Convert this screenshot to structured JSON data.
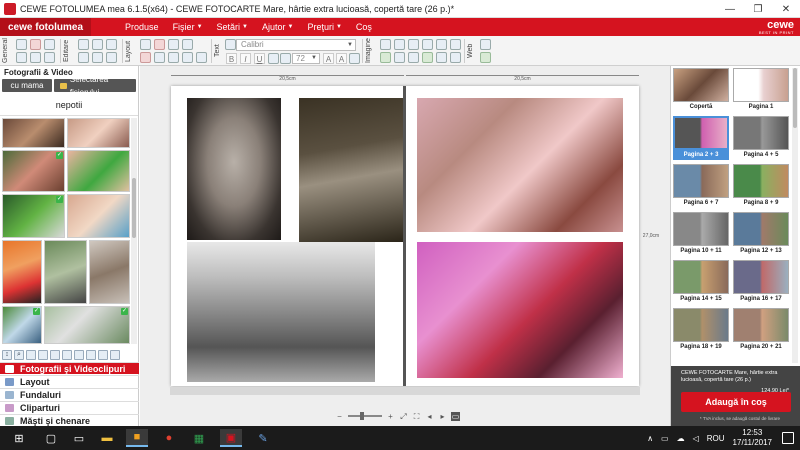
{
  "window": {
    "title": "CEWE FOTOLUMEA mea 6.1.5(x64) - CEWE FOTOCARTE Mare, hârtie extra lucioasă, copertă tare (26 p.)*",
    "controls": [
      "—",
      "❐",
      "✕"
    ]
  },
  "menubar": {
    "brand": "cewe fotolumea",
    "items": [
      "Produse",
      "Fişier",
      "Setări",
      "Ajutor",
      "Preţuri",
      "Coş"
    ],
    "logo_word": "cewe",
    "logo_sub": "BEST IN PRINT"
  },
  "toolbar": {
    "groups": [
      "General",
      "Editare",
      "Layout",
      "Text",
      "Imagine",
      "Web"
    ],
    "font_name": "Calibri",
    "font_size": "72"
  },
  "left_panel": {
    "heading": "Fotografii & Video",
    "tab_album": "cu mama",
    "tab_select": "Selectarea fişierului",
    "album_name": "nepotii",
    "sections": [
      "Fotografii şi Videoclipuri",
      "Layout",
      "Fundaluri",
      "Cliparturi",
      "Măşti şi chenare"
    ]
  },
  "canvas": {
    "ruler_left": "20,5cm",
    "ruler_right": "20,5cm",
    "ruler_vertical": "27,0cm"
  },
  "right_panel": {
    "pages": [
      "Copertă",
      "Pagina 1",
      "Pagina 2 + 3",
      "Pagina 4 + 5",
      "Pagina 6 + 7",
      "Pagina 8 + 9",
      "Pagina 10 + 11",
      "Pagina 12 + 13",
      "Pagina 14 + 15",
      "Pagina 16 + 17",
      "Pagina 18 + 19",
      "Pagina 20 + 21"
    ],
    "selected_page": "Pagina 2 + 3",
    "cart_text": "CEWE FOTOCARTE Mare, hârtie extra lucioasă, copertă tare (26 p.)",
    "price": "124,90 Lei*",
    "add_button": "Adaugă în coş",
    "note": "* TVA inclus, se adaugă costul de livrare"
  },
  "taskbar": {
    "language": "ROU",
    "time": "12:53",
    "date": "17/11/2017"
  }
}
